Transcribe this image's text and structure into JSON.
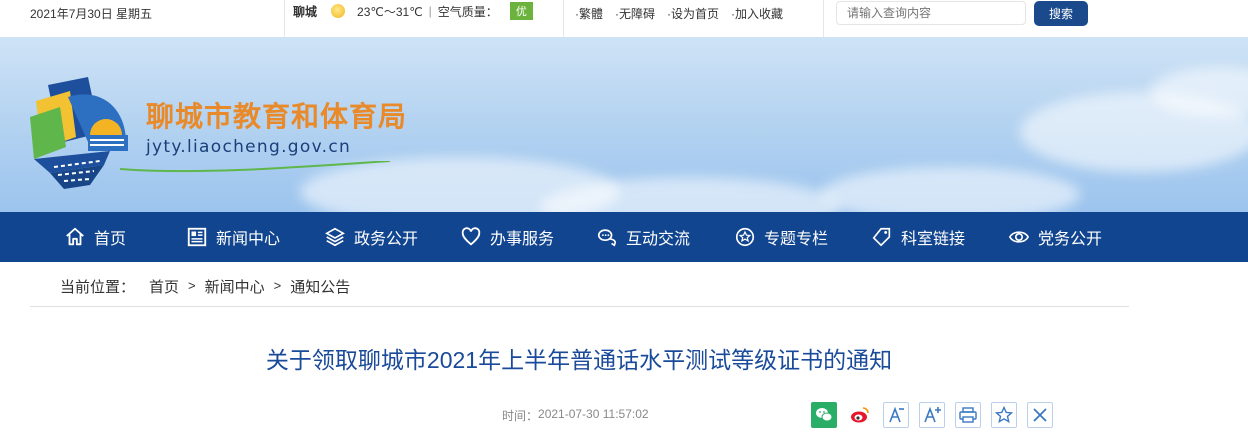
{
  "topbar": {
    "date": "2021年7月30日 星期五",
    "city": "聊城",
    "temperature": "23℃～31℃",
    "air_quality_label": "空气质量：",
    "air_quality_value": "优",
    "links": [
      "·繁體",
      "·无障碍",
      "·设为首页",
      "·加入收藏"
    ],
    "search_placeholder": "请输入查询内容",
    "search_button": "搜索"
  },
  "banner": {
    "site_name": "聊城市教育和体育局",
    "site_url": "jyty.liaocheng.gov.cn"
  },
  "nav": {
    "items": [
      {
        "label": "首页",
        "icon": "home-icon"
      },
      {
        "label": "新闻中心",
        "icon": "news-icon"
      },
      {
        "label": "政务公开",
        "icon": "layers-icon"
      },
      {
        "label": "办事服务",
        "icon": "heart-icon"
      },
      {
        "label": "互动交流",
        "icon": "chat-icon"
      },
      {
        "label": "专题专栏",
        "icon": "star-badge-icon"
      },
      {
        "label": "科室链接",
        "icon": "tag-icon"
      },
      {
        "label": "党务公开",
        "icon": "eye-icon"
      }
    ]
  },
  "breadcrumb": {
    "prefix": "当前位置：",
    "items": [
      "首页",
      "新闻中心",
      "通知公告"
    ],
    "separator": ">"
  },
  "article": {
    "title": "关于领取聊城市2021年上半年普通话水平测试等级证书的通知",
    "time_label": "时间：",
    "time_value": "2021-07-30 11:57:02"
  },
  "share": {
    "buttons": [
      "wechat-icon",
      "weibo-icon",
      "font-decrease-icon",
      "font-increase-icon",
      "print-icon",
      "favorite-icon",
      "close-icon"
    ],
    "font_letter": "A"
  },
  "colors": {
    "nav_bg": "#12458f",
    "site_name": "#e98a2a",
    "title": "#1a4a9a",
    "badge_green": "#6cb33e"
  }
}
